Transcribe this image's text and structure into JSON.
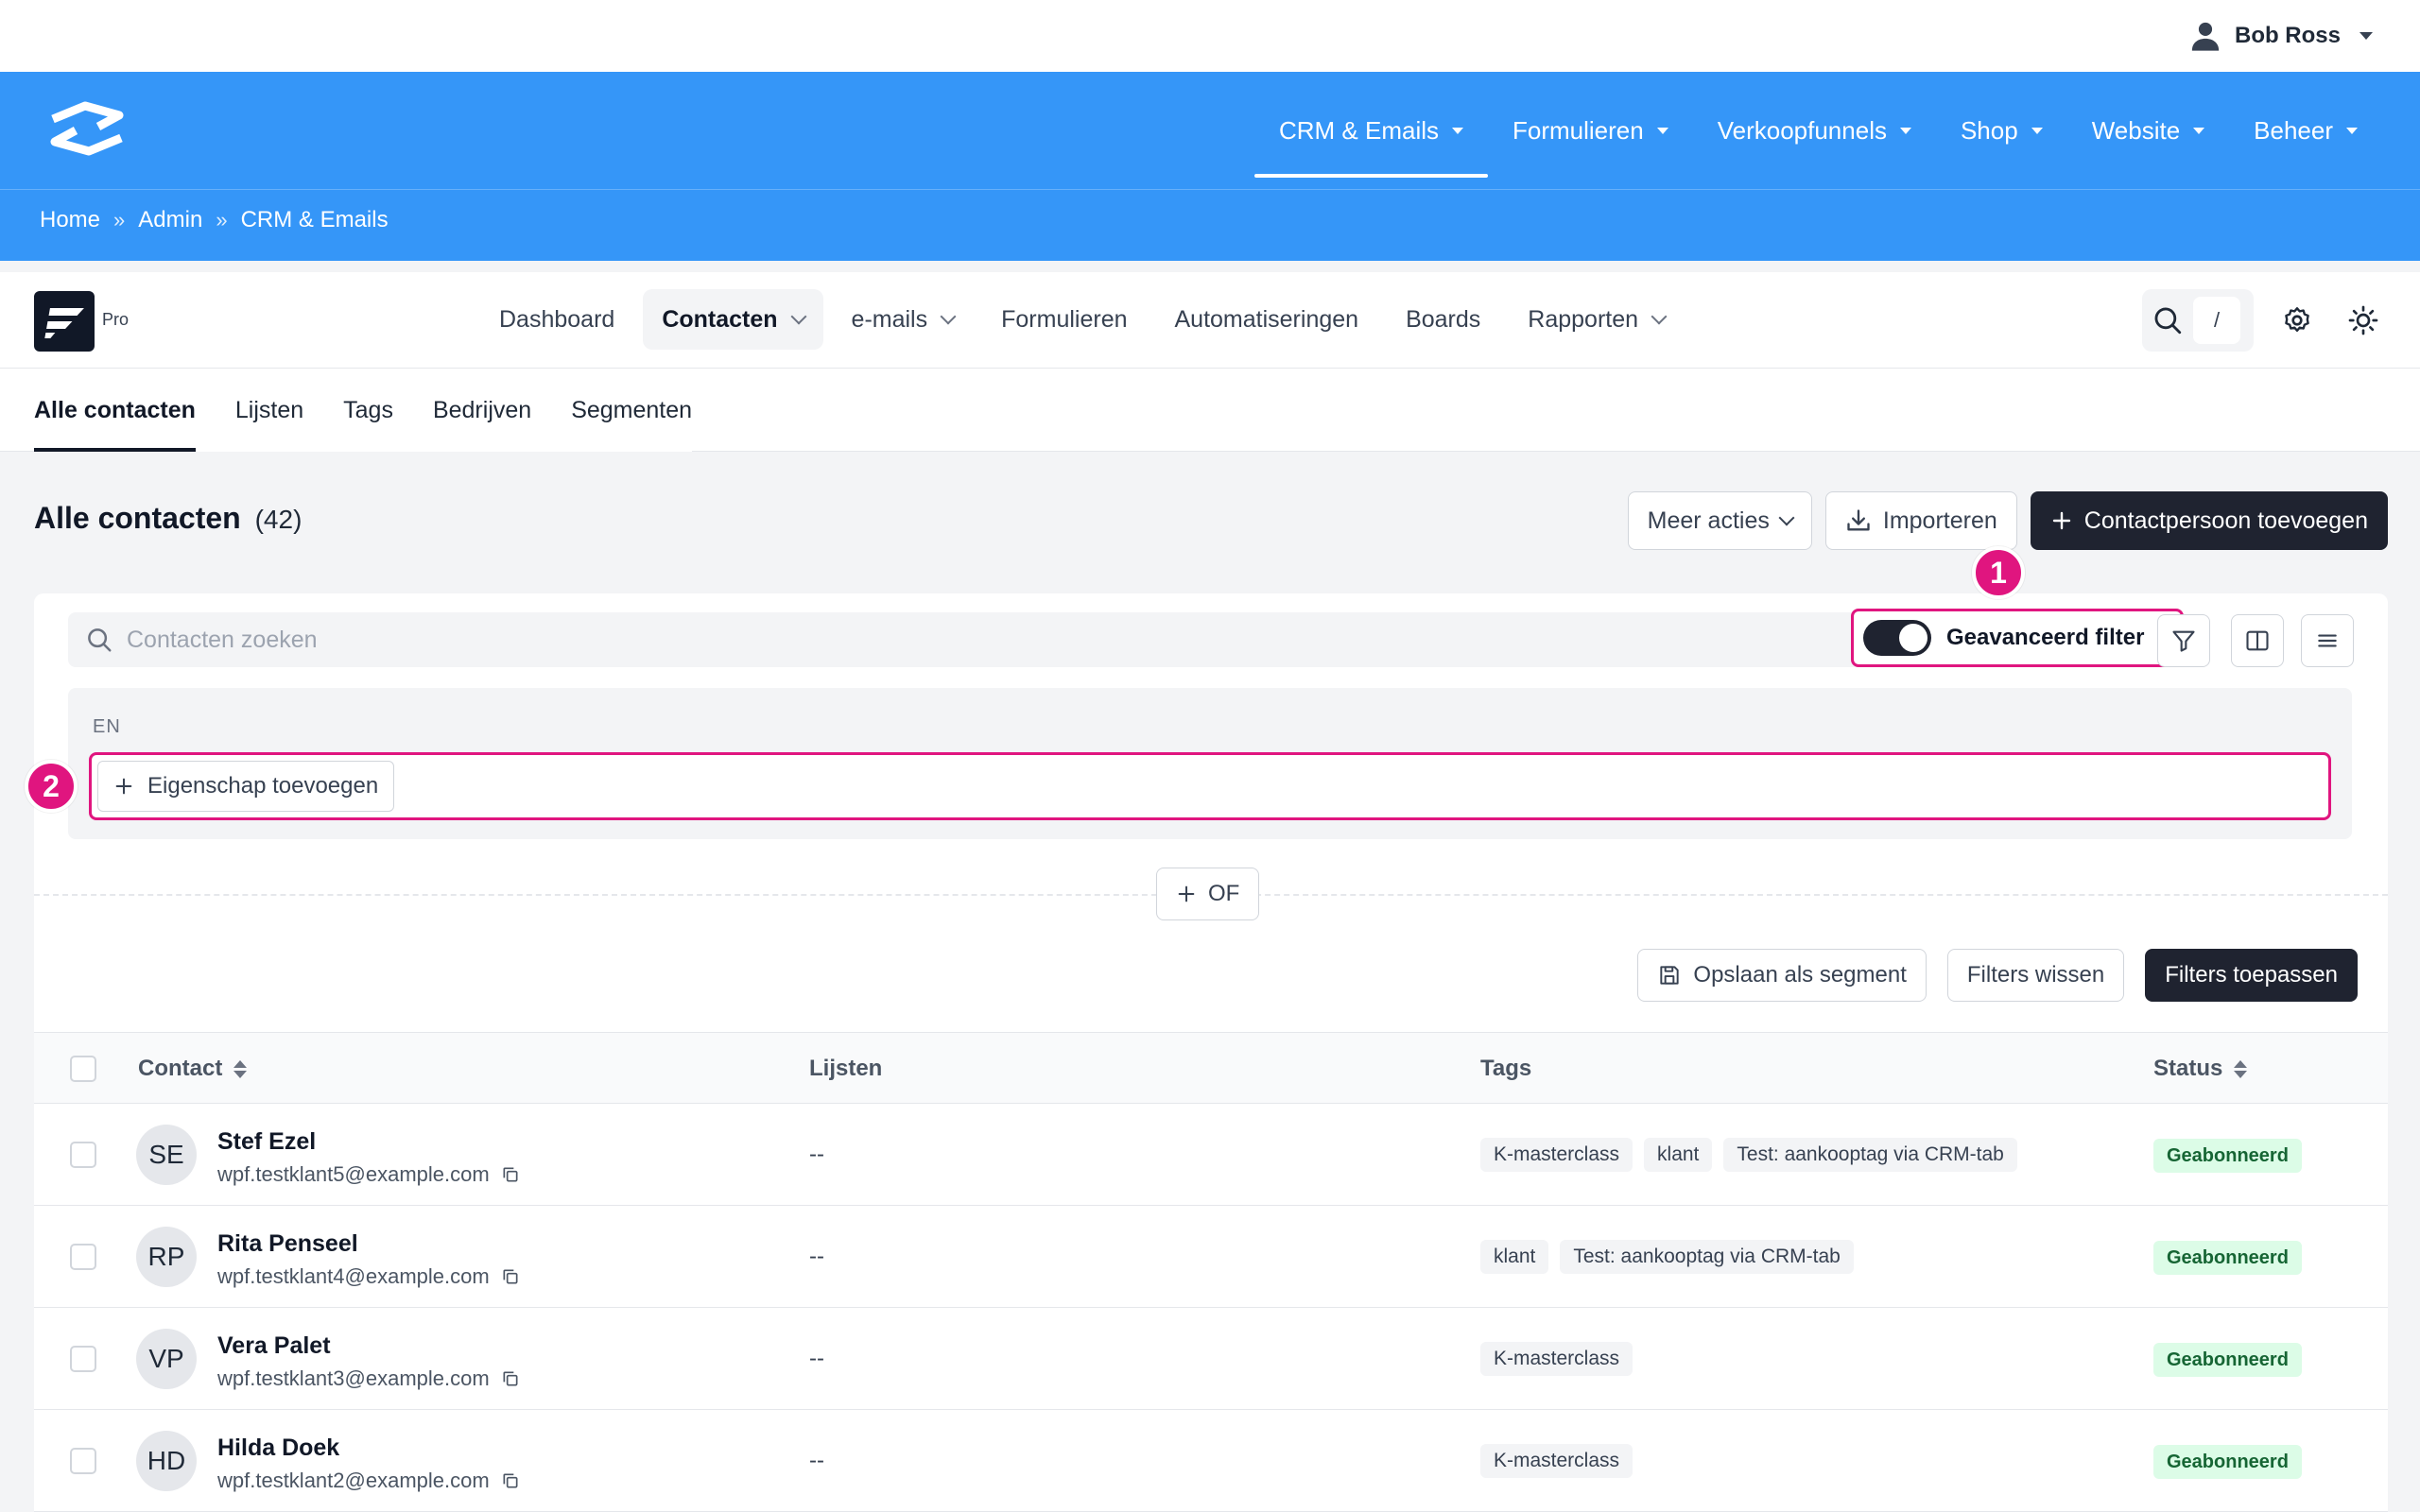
{
  "user": {
    "name": "Bob Ross"
  },
  "site_nav": {
    "items": [
      {
        "label": "CRM & Emails",
        "active": true
      },
      {
        "label": "Formulieren"
      },
      {
        "label": "Verkoopfunnels"
      },
      {
        "label": "Shop"
      },
      {
        "label": "Website"
      },
      {
        "label": "Beheer"
      }
    ]
  },
  "breadcrumb": [
    "Home",
    "Admin",
    "CRM & Emails"
  ],
  "breadcrumb_sep": "»",
  "app": {
    "badge": "Pro",
    "tabs": [
      {
        "label": "Dashboard"
      },
      {
        "label": "Contacten",
        "active": true
      },
      {
        "label": "e-mails"
      },
      {
        "label": "Formulieren"
      },
      {
        "label": "Automatiseringen"
      },
      {
        "label": "Boards"
      },
      {
        "label": "Rapporten"
      }
    ],
    "search_shortcut": "/"
  },
  "subtabs": [
    "Alle contacten",
    "Lijsten",
    "Tags",
    "Bedrijven",
    "Segmenten"
  ],
  "page": {
    "title": "Alle contacten",
    "count": "(42)",
    "more_actions": "Meer acties",
    "import": "Importeren",
    "add_contact": "Contactpersoon toevoegen"
  },
  "filter": {
    "search_placeholder": "Contacten zoeken",
    "advanced_label": "Geavanceerd filter",
    "marker_1": "1",
    "marker_2": "2",
    "group_label": "EN",
    "add_property": "Eigenschap toevoegen",
    "or_label": "OF",
    "save_segment": "Opslaan als segment",
    "clear": "Filters wissen",
    "apply": "Filters toepassen"
  },
  "table": {
    "headers": {
      "contact": "Contact",
      "lists": "Lijsten",
      "tags": "Tags",
      "status": "Status"
    },
    "rows": [
      {
        "initials": "SE",
        "name": "Stef Ezel",
        "email": "wpf.testklant5@example.com",
        "lists": "--",
        "tags": [
          "K-masterclass",
          "klant",
          "Test: aankooptag via CRM-tab"
        ],
        "status": "Geabonneerd"
      },
      {
        "initials": "RP",
        "name": "Rita Penseel",
        "email": "wpf.testklant4@example.com",
        "lists": "--",
        "tags": [
          "klant",
          "Test: aankooptag via CRM-tab"
        ],
        "status": "Geabonneerd"
      },
      {
        "initials": "VP",
        "name": "Vera Palet",
        "email": "wpf.testklant3@example.com",
        "lists": "--",
        "tags": [
          "K-masterclass"
        ],
        "status": "Geabonneerd"
      },
      {
        "initials": "HD",
        "name": "Hilda Doek",
        "email": "wpf.testklant2@example.com",
        "lists": "--",
        "tags": [
          "K-masterclass"
        ],
        "status": "Geabonneerd"
      }
    ]
  },
  "colors": {
    "brand_blue": "#3596f8",
    "highlight": "#e0157f",
    "dark": "#1f2330",
    "success_bg": "#dcfce7"
  }
}
